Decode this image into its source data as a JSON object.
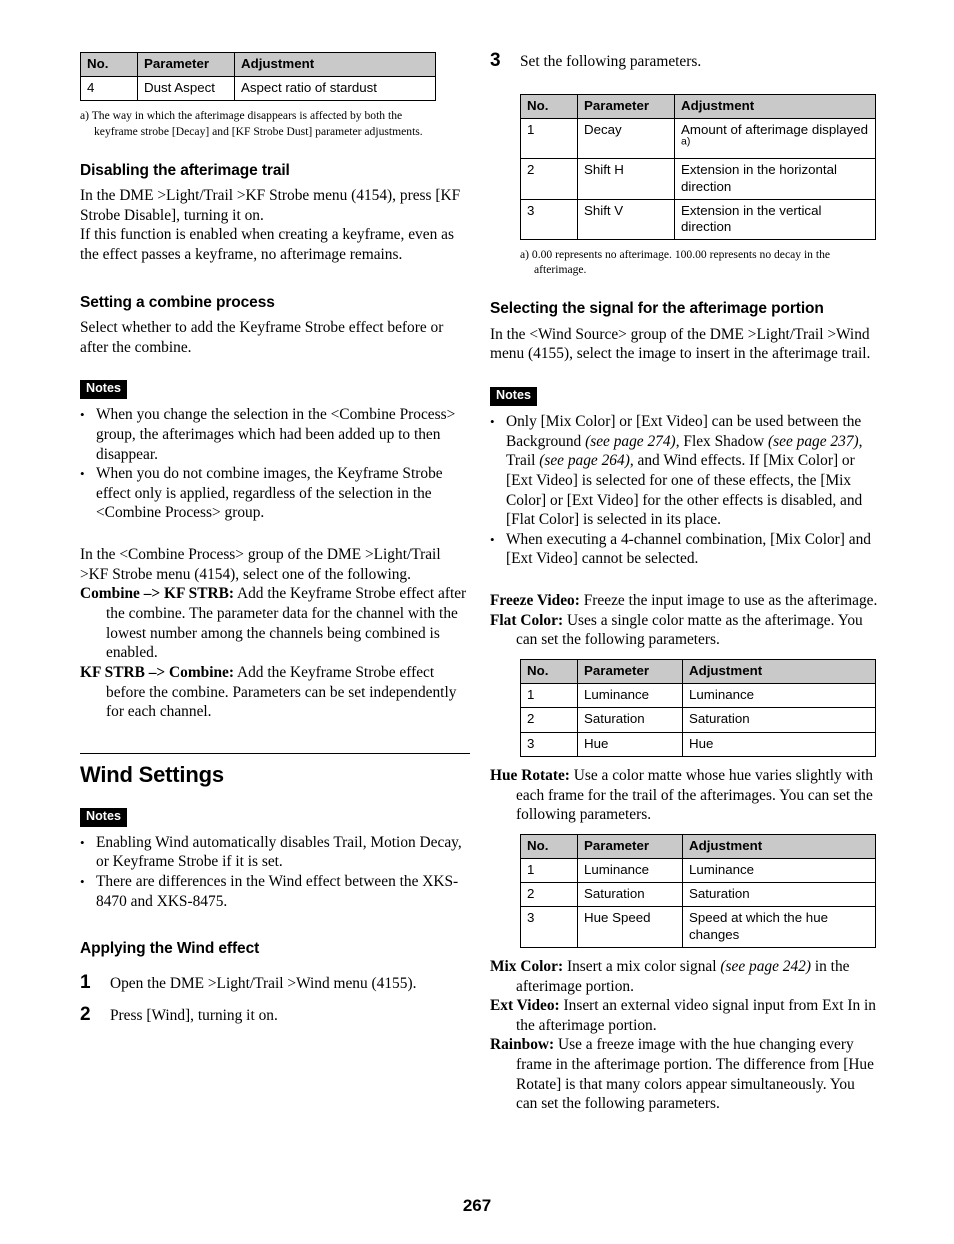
{
  "page": {
    "number": "267"
  },
  "tables": {
    "headers": [
      "No.",
      "Parameter",
      "Adjustment"
    ],
    "kf_strobe_dust": {
      "rows": [
        {
          "no": "4",
          "parameter": "Dust Aspect",
          "adjustment": "Aspect ratio of stardust"
        }
      ]
    },
    "wind_params": {
      "rows": [
        {
          "no": "1",
          "parameter": "Decay",
          "adjustment": "Amount of afterimage displayed",
          "footnote_marker": "a)"
        },
        {
          "no": "2",
          "parameter": "Shift H",
          "adjustment": "Extension in the horizontal direction"
        },
        {
          "no": "3",
          "parameter": "Shift V",
          "adjustment": "Extension in the vertical direction"
        }
      ]
    },
    "flat_color": {
      "rows": [
        {
          "no": "1",
          "parameter": "Luminance",
          "adjustment": "Luminance"
        },
        {
          "no": "2",
          "parameter": "Saturation",
          "adjustment": "Saturation"
        },
        {
          "no": "3",
          "parameter": "Hue",
          "adjustment": "Hue"
        }
      ]
    },
    "hue_rotate": {
      "rows": [
        {
          "no": "1",
          "parameter": "Luminance",
          "adjustment": "Luminance"
        },
        {
          "no": "2",
          "parameter": "Saturation",
          "adjustment": "Saturation"
        },
        {
          "no": "3",
          "parameter": "Hue Speed",
          "adjustment": "Speed at which the hue changes"
        }
      ]
    }
  },
  "left_column": {
    "footnote_a": "a) The way in which the afterimage disappears is affected by both the keyframe strobe [Decay] and [KF Strobe Dust] parameter adjustments.",
    "disabling_afterimage": {
      "heading": "Disabling the afterimage trail",
      "paragraph1": "In the DME >Light/Trail >KF Strobe menu (4154), press [KF Strobe Disable], turning it on.",
      "paragraph2": "If this function is enabled when creating a keyframe, even as the effect passes a keyframe, no afterimage remains."
    },
    "combine_process": {
      "heading": "Setting a combine process",
      "paragraph1": "Select whether to add the Keyframe Strobe effect before or after the combine.",
      "notes_label": "Notes",
      "notes": [
        "When you change the selection in the <Combine Process> group, the afterimages which had been added up to then disappear.",
        "When you do not combine images, the Keyframe Strobe effect only is applied, regardless of the selection in the <Combine Process> group."
      ],
      "paragraph2": "In the <Combine Process> group of the DME >Light/Trail >KF Strobe menu (4154), select one of the following.",
      "options": [
        {
          "term": "Combine –> KF STRB:",
          "desc": " Add the Keyframe Strobe effect after the combine. The parameter data for the channel with the lowest number among the channels being combined is enabled."
        },
        {
          "term": "KF STRB –> Combine:",
          "desc": " Add the Keyframe Strobe effect before the combine. Parameters can be set independently for each channel."
        }
      ]
    },
    "wind_settings": {
      "heading": "Wind Settings",
      "notes_label": "Notes",
      "notes": [
        "Enabling Wind automatically disables Trail, Motion Decay, or Keyframe Strobe if it is set.",
        "There are differences in the Wind effect between the XKS-8470 and XKS-8475."
      ],
      "applying": {
        "heading": "Applying the Wind effect",
        "steps": [
          {
            "num": "1",
            "text": "Open the DME >Light/Trail >Wind menu (4155)."
          },
          {
            "num": "2",
            "text": "Press [Wind], turning it on."
          }
        ]
      }
    }
  },
  "right_column": {
    "step3": {
      "num": "3",
      "text": "Set the following parameters."
    },
    "footnote_a": "a) 0.00 represents no afterimage. 100.00 represents no decay in the afterimage.",
    "selecting_signal": {
      "heading": "Selecting the signal for the afterimage portion",
      "paragraph1": "In the <Wind Source> group of the DME >Light/Trail >Wind menu (4155), select the image to insert in the afterimage trail.",
      "notes_label": "Notes",
      "notes": [
        {
          "segments": [
            {
              "text": "Only [Mix Color] or [Ext Video] can be used between the Background ",
              "italic": false
            },
            {
              "text": "(see page 274)",
              "italic": true
            },
            {
              "text": ", Flex Shadow ",
              "italic": false
            },
            {
              "text": "(see page 237)",
              "italic": true
            },
            {
              "text": ", Trail ",
              "italic": false
            },
            {
              "text": "(see page 264)",
              "italic": true
            },
            {
              "text": ", and Wind effects. If [Mix Color] or [Ext Video] is selected for one of these effects, the [Mix Color] or [Ext Video] for the other effects is disabled, and [Flat Color] is selected in its place.",
              "italic": false
            }
          ]
        },
        {
          "segments": [
            {
              "text": "When executing a 4-channel combination, [Mix Color] and [Ext Video] cannot be selected.",
              "italic": false
            }
          ]
        }
      ],
      "definitions_top": [
        {
          "term": "Freeze Video:",
          "desc": " Freeze the input image to use as the afterimage."
        },
        {
          "term": "Flat Color:",
          "desc": " Uses a single color matte as the afterimage. You can set the following parameters."
        }
      ],
      "hue_rotate_def": {
        "term": "Hue Rotate:",
        "desc": " Use a color matte whose hue varies slightly with each frame for the trail of the afterimages. You can set the following parameters."
      },
      "definitions_bottom": [
        {
          "term": "Mix Color:",
          "segments": [
            {
              "text": " Insert a mix color signal ",
              "italic": false
            },
            {
              "text": "(see page 242)",
              "italic": true
            },
            {
              "text": " in the afterimage portion.",
              "italic": false
            }
          ]
        },
        {
          "term": "Ext Video:",
          "segments": [
            {
              "text": " Insert an external video signal input from Ext In in the afterimage portion.",
              "italic": false
            }
          ]
        },
        {
          "term": "Rainbow:",
          "segments": [
            {
              "text": " Use a freeze image with the hue changing every frame in the afterimage portion. The difference from [Hue Rotate] is that many colors appear simultaneously. You can set the following parameters.",
              "italic": false
            }
          ]
        }
      ]
    }
  }
}
